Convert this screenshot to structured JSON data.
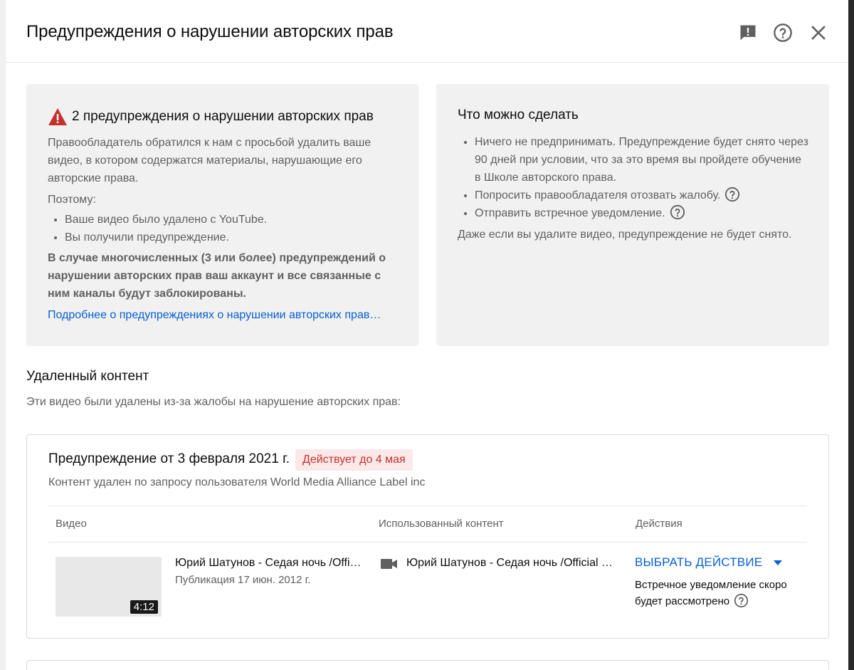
{
  "dialog": {
    "title": "Предупреждения о нарушении авторских прав",
    "icons": [
      "feedback-icon",
      "help-icon",
      "close-icon"
    ]
  },
  "strikes_card": {
    "heading": "2 предупреждения о нарушении авторских прав",
    "paragraph": "Правообладатель обратился к нам с просьбой удалить ваше видео, в котором содержатся материалы, нарушающие его авторские права.",
    "therefore": "Поэтому:",
    "bullets": [
      "Ваше видео было удалено с YouTube.",
      "Вы получили предупреждение."
    ],
    "bold_warning": "В случае многочисленных (3 или более) предупреждений о нарушении авторских прав ваш аккаунт и все связанные с ним каналы будут заблокированы.",
    "link": "Подробнее о предупреждениях о нарушении авторских прав…"
  },
  "options_card": {
    "heading": "Что можно сделать",
    "bullets": [
      "Ничего не предпринимать. Предупреждение будет снято через 90 дней при условии, что за это время вы пройдете обучение в Школе авторского права.",
      "Попросить правообладателя отозвать жалобу.",
      "Отправить встречное уведомление."
    ],
    "footer": "Даже если вы удалите видео, предупреждение не будет снято."
  },
  "removed": {
    "title": "Удаленный контент",
    "subtitle": "Эти видео были удалены из-за жалобы на нарушение авторских прав:"
  },
  "strike": {
    "title": "Предупреждение от 3 февраля 2021 г.",
    "badge": "Действует до 4 мая",
    "claimant": "Контент удален по запросу пользователя World Media Alliance Label inc",
    "columns": [
      "Видео",
      "Использованный контент",
      "Действия"
    ],
    "video_title": "Юрий Шатунов - Седая ночь /Official Video",
    "video_published": "Публикация 17 июн. 2012 г.",
    "duration": "4:12",
    "content_title": "Юрий Шатунов - Седая ночь /Official Video",
    "action_label": "ВЫБРАТЬ ДЕЙСТВИЕ",
    "action_note": "Встречное уведомление скоро будет рассмотрено"
  },
  "colors": {
    "accent": "#065fd4",
    "warning": "#c4302b",
    "card_bg": "#f1f1f1",
    "badge_bg": "#fbe9e9"
  }
}
